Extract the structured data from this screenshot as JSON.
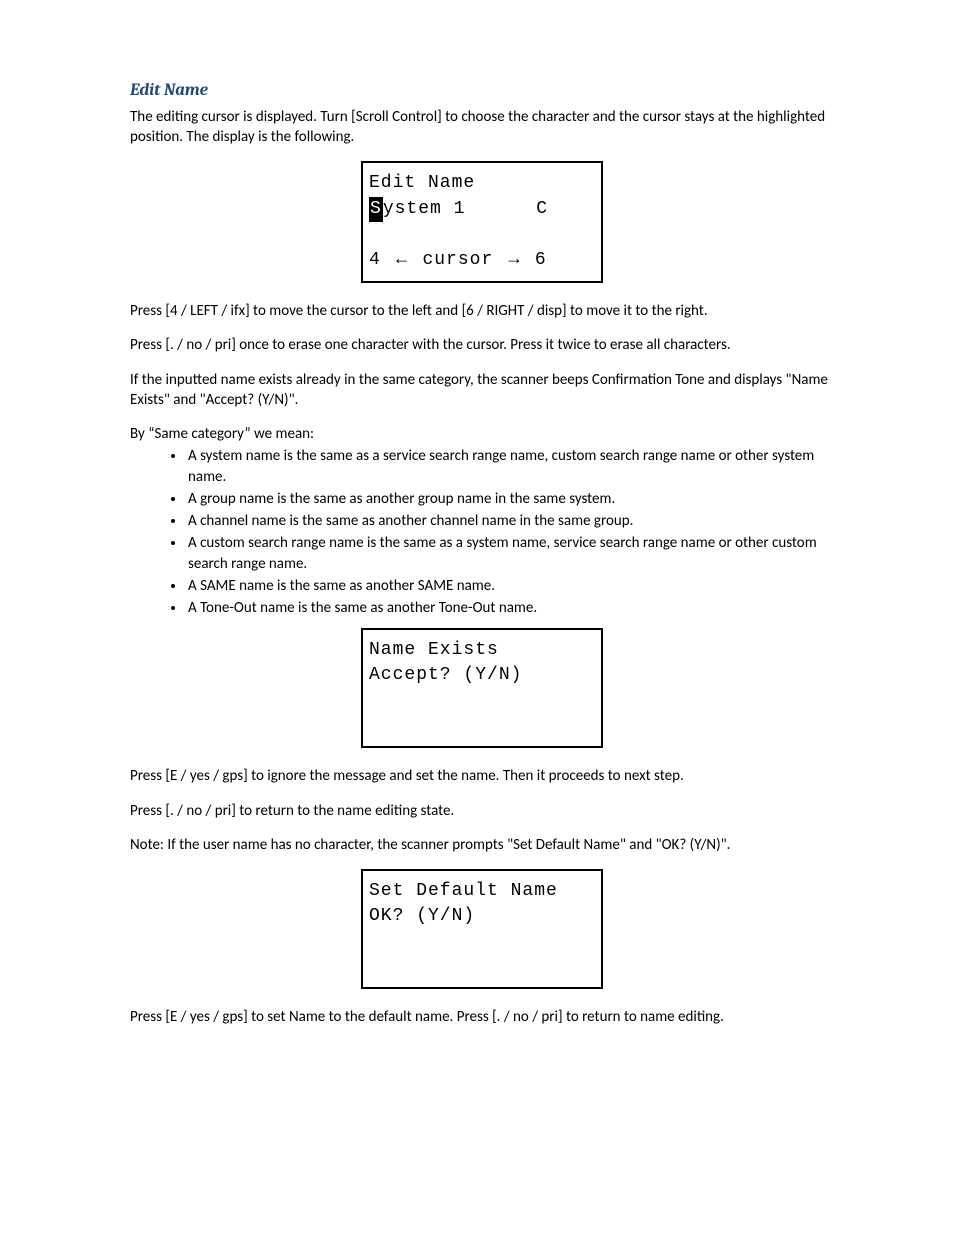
{
  "heading": "Edit Name",
  "intro": "The editing cursor is displayed. Turn [Scroll Control] to choose the character and the cursor stays at the highlighted position. The display is the following.",
  "lcd1": {
    "line1": "Edit Name",
    "line2_cursor_char": "S",
    "line2_rest": "ystem 1",
    "line2_right": "C",
    "line4_left": "4",
    "line4_mid": "cursor",
    "line4_right": "6"
  },
  "p2": "Press [4 / LEFT / ifx] to move the cursor to the left and [6 / RIGHT / disp] to move it to the right.",
  "p3": "Press [. / no / pri] once to erase one character with the cursor. Press it twice to erase all characters.",
  "p4": "If the inputted name exists already in the same category, the scanner beeps Confirmation Tone and displays \"Name Exists\" and \"Accept? (Y/N)\".",
  "p5": "By “Same category” we mean:",
  "bullets": [
    "A system name is the same as a service search range name, custom search range name or other system name.",
    "A group name is the same as another group name in the same system.",
    "A channel name is the same as another channel name in the same group.",
    "A custom search range name is the same as a system name, service search range name or other custom search range name.",
    "A SAME name is the same as another SAME name.",
    "A Tone-Out name is the same as another Tone-Out name."
  ],
  "lcd2": {
    "line1": "Name Exists",
    "line2": "  Accept? (Y/N)"
  },
  "p6": "Press [E / yes / gps] to ignore the message and set the name. Then it proceeds to next step.",
  "p7": "Press [. / no / pri] to return to the name editing state.",
  "p8": "Note: If the user name has no character, the scanner prompts \"Set Default Name\" and \"OK? (Y/N)\".",
  "lcd3": {
    "line1": "Set Default Name",
    "line2": " OK? (Y/N)"
  },
  "p9": "Press [E / yes / gps] to set Name to the default name. Press [. / no / pri] to return to name editing."
}
